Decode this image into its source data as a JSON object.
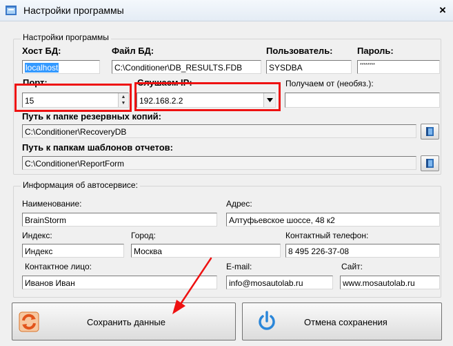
{
  "window": {
    "title": "Настройки программы",
    "close_label": "×"
  },
  "group_settings": {
    "legend": "Настройки программы",
    "host_label": "Хост БД:",
    "host_value": "localhost",
    "file_label": "Файл БД:",
    "file_value": "C:\\Conditioner\\DB_RESULTS.FDB",
    "user_label": "Пользователь:",
    "user_value": "SYSDBA",
    "password_label": "Пароль:",
    "password_value": "********",
    "port_label": "Порт:",
    "port_value": "15",
    "listen_ip_label": "Слушаем IP:",
    "listen_ip_value": "192.168.2.2",
    "receive_from_label": "Получаем от (необяз.):",
    "receive_from_value": "",
    "backup_path_label": "Путь к папке резервных копий:",
    "backup_path_value": "C:\\Conditioner\\RecoveryDB",
    "templates_path_label": "Путь к папкам шаблонов отчетов:",
    "templates_path_value": "C:\\Conditioner\\ReportForm"
  },
  "group_service": {
    "legend": "Информация об автосервисе:",
    "name_label": "Наименование:",
    "name_value": "BrainStorm",
    "address_label": "Адрес:",
    "address_value": "Алтуфьевское шоссе, 48 к2",
    "index_label": "Индекс:",
    "index_value": "Индекс",
    "city_label": "Город:",
    "city_value": "Москва",
    "phone_label": "Контактный телефон:",
    "phone_value": "8 495 226-37-08",
    "contact_label": "Контактное лицо:",
    "contact_value": "Иванов Иван",
    "email_label": "E-mail:",
    "email_value": "info@mosautolab.ru",
    "site_label": "Сайт:",
    "site_value": "www.mosautolab.ru"
  },
  "buttons": {
    "save_label": "Сохранить данные",
    "cancel_label": "Отмена сохранения"
  },
  "colors": {
    "annotation_red": "#ee1111",
    "selection_blue": "#3399ff"
  }
}
